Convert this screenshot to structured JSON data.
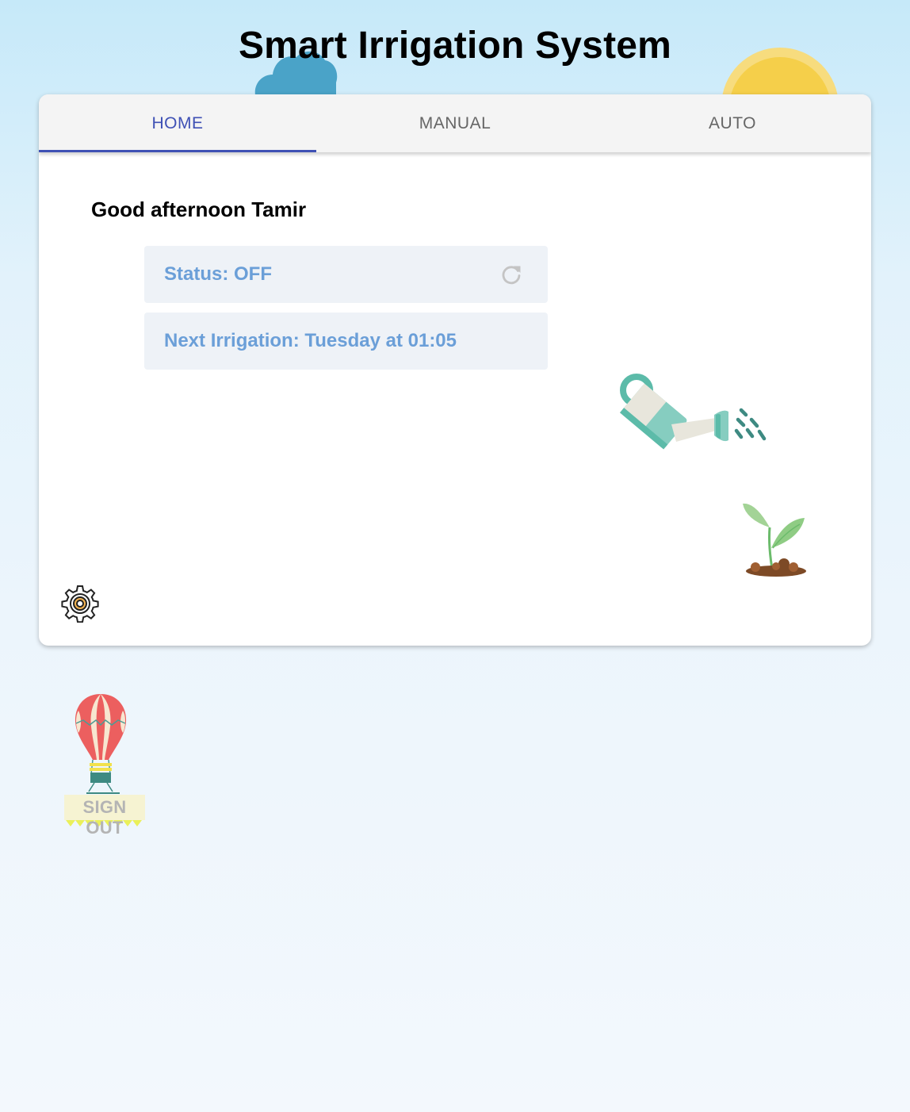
{
  "app": {
    "title": "Smart Irrigation System"
  },
  "tabs": [
    {
      "label": "HOME",
      "active": true
    },
    {
      "label": "MANUAL",
      "active": false
    },
    {
      "label": "AUTO",
      "active": false
    }
  ],
  "home": {
    "greeting": "Good afternoon Tamir",
    "status_text": "Status: OFF",
    "next_irrigation_text": "Next Irrigation: Tuesday at 01:05"
  },
  "actions": {
    "sign_out_label": "SIGN OUT"
  },
  "icons": {
    "refresh": "refresh-icon",
    "settings": "gear-icon",
    "watering_can": "watering-can-icon",
    "plant": "sprout-icon",
    "balloon": "hot-air-balloon-icon",
    "cloud": "cloud-icon",
    "sun": "sun-icon"
  },
  "colors": {
    "accent": "#3f51b5",
    "info_text": "#6b9fd8",
    "info_background": "#eef2f7",
    "tab_bar": "#f4f4f4"
  }
}
